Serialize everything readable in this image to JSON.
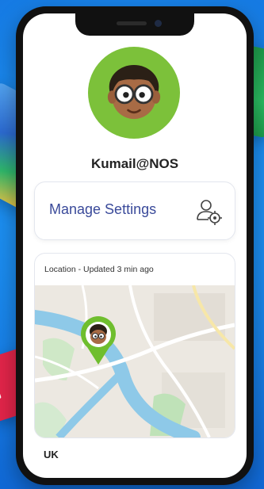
{
  "profile": {
    "username": "Kumail@NOS"
  },
  "settings": {
    "manage_label": "Manage Settings"
  },
  "location": {
    "status_text": "Location - Updated 3 min ago",
    "country": "UK"
  },
  "icons": {
    "manage": "user-gear-icon",
    "pin": "map-pin-icon"
  },
  "colors": {
    "background": "#1b8cf0",
    "avatar_bg": "#7cc13a",
    "accent_text": "#3a4a9a",
    "pin": "#6fbe2e"
  }
}
